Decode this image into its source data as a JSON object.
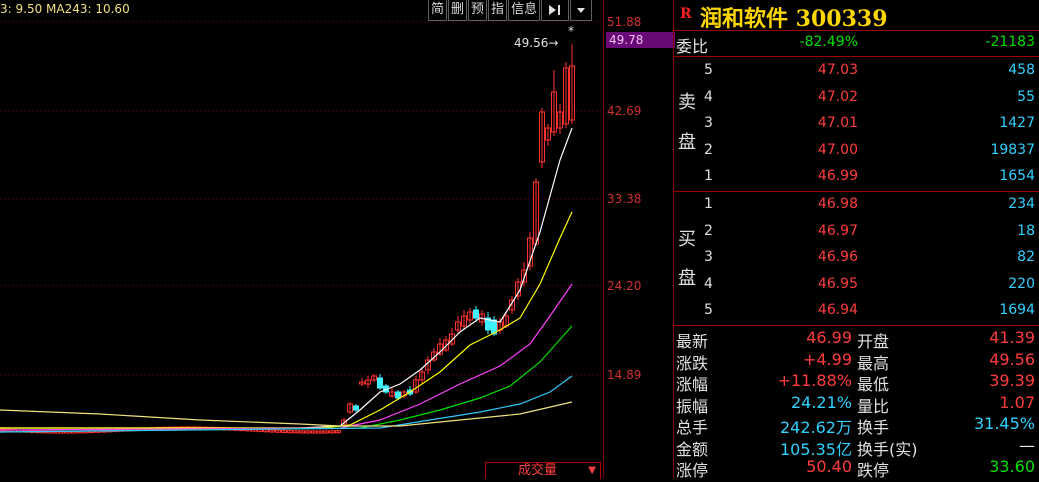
{
  "chart": {
    "ma_label": "3: 9.50 MA243: 10.60",
    "toolbar": [
      "简",
      "删",
      "预",
      "指",
      "信息"
    ],
    "toolbar_icons": [
      "skip-right-icon",
      "dropdown-icon"
    ],
    "price_levels": [
      "51.88",
      "42.69",
      "33.38",
      "24.20",
      "14.89"
    ],
    "current_price_tag": "49.78",
    "high_marker": "49.56",
    "high_star": "*",
    "volume_tab": "成交量",
    "colors": {
      "up": "#ff3030",
      "down": "#40f0ff",
      "ma5": "#ffffff",
      "ma10": "#ffff00",
      "ma20": "#ff40ff",
      "ma60": "#00e000",
      "ma120": "#30c8ff",
      "ma243": "#f0e080"
    }
  },
  "stock": {
    "badge": "R",
    "name": "润和软件 300339"
  },
  "weibi": {
    "label": "委比",
    "ratio": "-82.49%",
    "diff": "-21183"
  },
  "sell": {
    "label_top": "卖",
    "label_bottom": "盘",
    "rows": [
      {
        "level": "5",
        "price": "47.03",
        "volume": "458"
      },
      {
        "level": "4",
        "price": "47.02",
        "volume": "55"
      },
      {
        "level": "3",
        "price": "47.01",
        "volume": "1427"
      },
      {
        "level": "2",
        "price": "47.00",
        "volume": "19837"
      },
      {
        "level": "1",
        "price": "46.99",
        "volume": "1654"
      }
    ]
  },
  "buy": {
    "label_top": "买",
    "label_bottom": "盘",
    "rows": [
      {
        "level": "1",
        "price": "46.98",
        "volume": "234"
      },
      {
        "level": "2",
        "price": "46.97",
        "volume": "18"
      },
      {
        "level": "3",
        "price": "46.96",
        "volume": "82"
      },
      {
        "level": "4",
        "price": "46.95",
        "volume": "220"
      },
      {
        "level": "5",
        "price": "46.94",
        "volume": "1694"
      }
    ]
  },
  "stats": [
    {
      "k1": "最新",
      "v1": "46.99",
      "c1": "red",
      "k2": "开盘",
      "v2": "41.39",
      "c2": "red"
    },
    {
      "k1": "涨跌",
      "v1": "+4.99",
      "c1": "red",
      "k2": "最高",
      "v2": "49.56",
      "c2": "red"
    },
    {
      "k1": "涨幅",
      "v1": "+11.88%",
      "c1": "red",
      "k2": "最低",
      "v2": "39.39",
      "c2": "red"
    },
    {
      "k1": "振幅",
      "v1": "24.21%",
      "c1": "cyan",
      "k2": "量比",
      "v2": "1.07",
      "c2": "red"
    },
    {
      "k1": "总手",
      "v1": "242.62万",
      "c1": "cyan",
      "k2": "换手",
      "v2": "31.45%",
      "c2": "cyan"
    },
    {
      "k1": "金额",
      "v1": "105.35亿",
      "c1": "cyan",
      "k2": "换手(实)",
      "v2": "—",
      "c2": "white"
    },
    {
      "k1": "涨停",
      "v1": "50.40",
      "c1": "red",
      "k2": "跌停",
      "v2": "33.60",
      "c2": "green"
    }
  ]
}
